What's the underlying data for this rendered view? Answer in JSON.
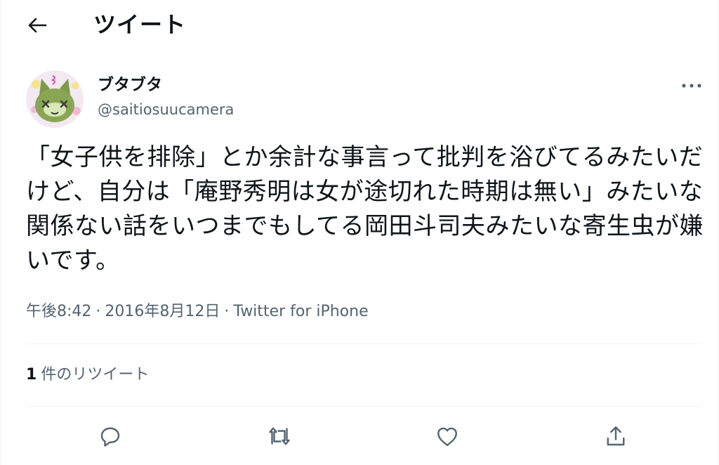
{
  "header": {
    "back_icon": "arrow-left-icon",
    "title": "ツイート"
  },
  "tweet": {
    "author": {
      "display_name": "ブタブタ",
      "handle": "@saitiosuucamera",
      "avatar": "cat-avatar"
    },
    "more_icon": "more-horizontal-icon",
    "text": "「女子供を排除」とか余計な事言って批判を浴びてるみたいだけど、自分は「庵野秀明は女が途切れた時期は無い」みたいな関係ない話をいつまでもしてる岡田斗司夫みたいな寄生虫が嫌いです。",
    "time": "午後8:42",
    "date": "2016年8月12日",
    "separator": "·",
    "source": "Twitter for iPhone",
    "retweets": {
      "count": "1",
      "label": "件のリツイート"
    },
    "actions": [
      {
        "icon": "reply-icon"
      },
      {
        "icon": "retweet-icon"
      },
      {
        "icon": "like-icon"
      },
      {
        "icon": "share-icon"
      }
    ]
  },
  "colors": {
    "text_primary": "#0f1419",
    "text_secondary": "#536471",
    "divider": "#eff3f4"
  }
}
